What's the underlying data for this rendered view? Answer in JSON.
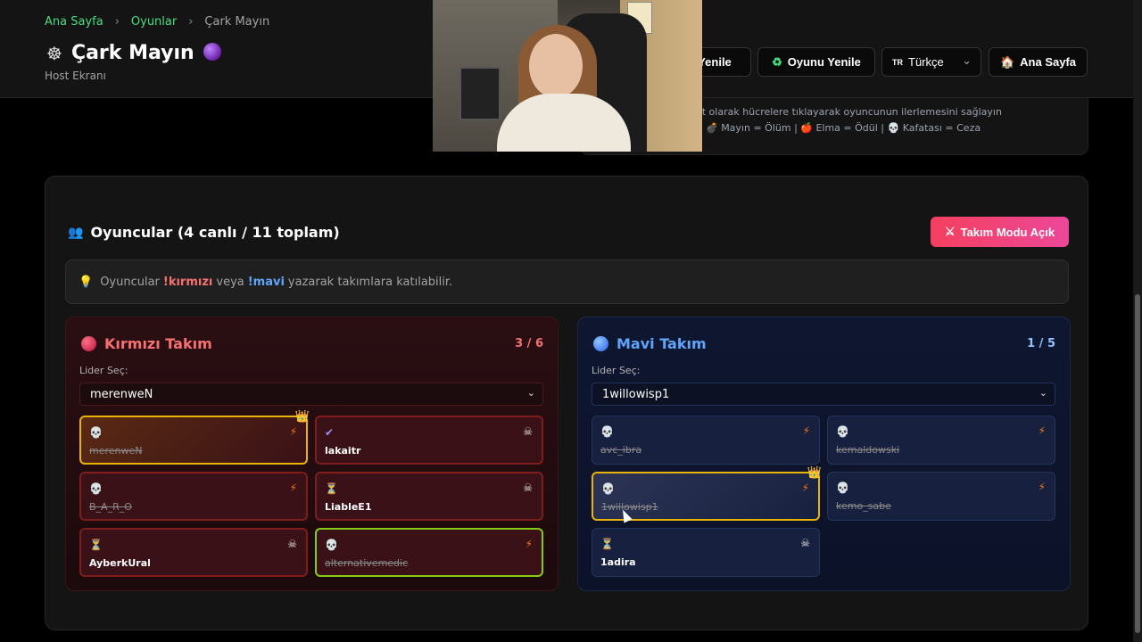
{
  "breadcrumb": {
    "home": "Ana Sayfa",
    "games": "Oyunlar",
    "current": "Çark Mayın",
    "separator": "›"
  },
  "header": {
    "title_icon": "☸",
    "title": "Çark Mayın",
    "subtitle": "Host Ekranı",
    "buttons": {
      "refresh_partial": "Yenile",
      "restart_game": "Oyunu Yenile",
      "restart_icon": "♻",
      "language": "Türkçe",
      "language_code": "TR",
      "home": "Ana Sayfa",
      "home_icon": "🏠"
    }
  },
  "info": {
    "line1": "st olarak hücrelere tıklayarak oyuncunun ilerlemesini sağlayın",
    "line2": "💣 Mayın = Ölüm | 🍎 Elma = Ödül | 💀 Kafatası = Ceza"
  },
  "players": {
    "icon": "👥",
    "title": "Oyuncular (4 canlı / 11 toplam)",
    "team_mode_button": "Takım Modu Açık",
    "team_mode_icon": "⚔",
    "hint": {
      "prefix": "Oyuncular",
      "red_cmd": "!kırmızı",
      "middle": "veya",
      "blue_cmd": "!mavi",
      "suffix": "yazarak takımlara katılabilir."
    }
  },
  "red_team": {
    "name": "Kırmızı Takım",
    "count": "3 / 6",
    "leader_label": "Lider Seç:",
    "leader_value": "merenweN",
    "players": [
      {
        "name": "merenweN",
        "state": "skull",
        "action": "bolt",
        "leader": true,
        "dead": true
      },
      {
        "name": "lakaitr",
        "state": "check",
        "action": "cross",
        "leader": false,
        "dead": false
      },
      {
        "name": "B_A_R_O",
        "state": "skull",
        "action": "bolt",
        "leader": false,
        "dead": true
      },
      {
        "name": "LiableE1",
        "state": "hourglass",
        "action": "cross",
        "leader": false,
        "dead": false
      },
      {
        "name": "AyberkUral",
        "state": "hourglass",
        "action": "cross",
        "leader": false,
        "dead": false
      },
      {
        "name": "alternativemedic",
        "state": "skull",
        "action": "bolt",
        "leader": false,
        "dead": true,
        "winner": true
      }
    ]
  },
  "blue_team": {
    "name": "Mavi Takım",
    "count": "1 / 5",
    "leader_label": "Lider Seç:",
    "leader_value": "1willowisp1",
    "players": [
      {
        "name": "avc_ibra",
        "state": "skull",
        "action": "bolt",
        "dead": true
      },
      {
        "name": "kemaldowski",
        "state": "skull",
        "action": "bolt",
        "dead": true
      },
      {
        "name": "1willowisp1",
        "state": "skull",
        "action": "bolt",
        "leader": true,
        "dead": true
      },
      {
        "name": "kemo_sabe",
        "state": "skull",
        "action": "bolt",
        "dead": true
      },
      {
        "name": "1adira",
        "state": "hourglass",
        "action": "cross",
        "dead": false
      }
    ]
  },
  "icons": {
    "skull": "💀",
    "check": "✔",
    "hourglass": "⏳",
    "bolt": "⚡",
    "cross": "☠",
    "crown": "👑",
    "bulb": "💡",
    "chevron": "⌄"
  }
}
